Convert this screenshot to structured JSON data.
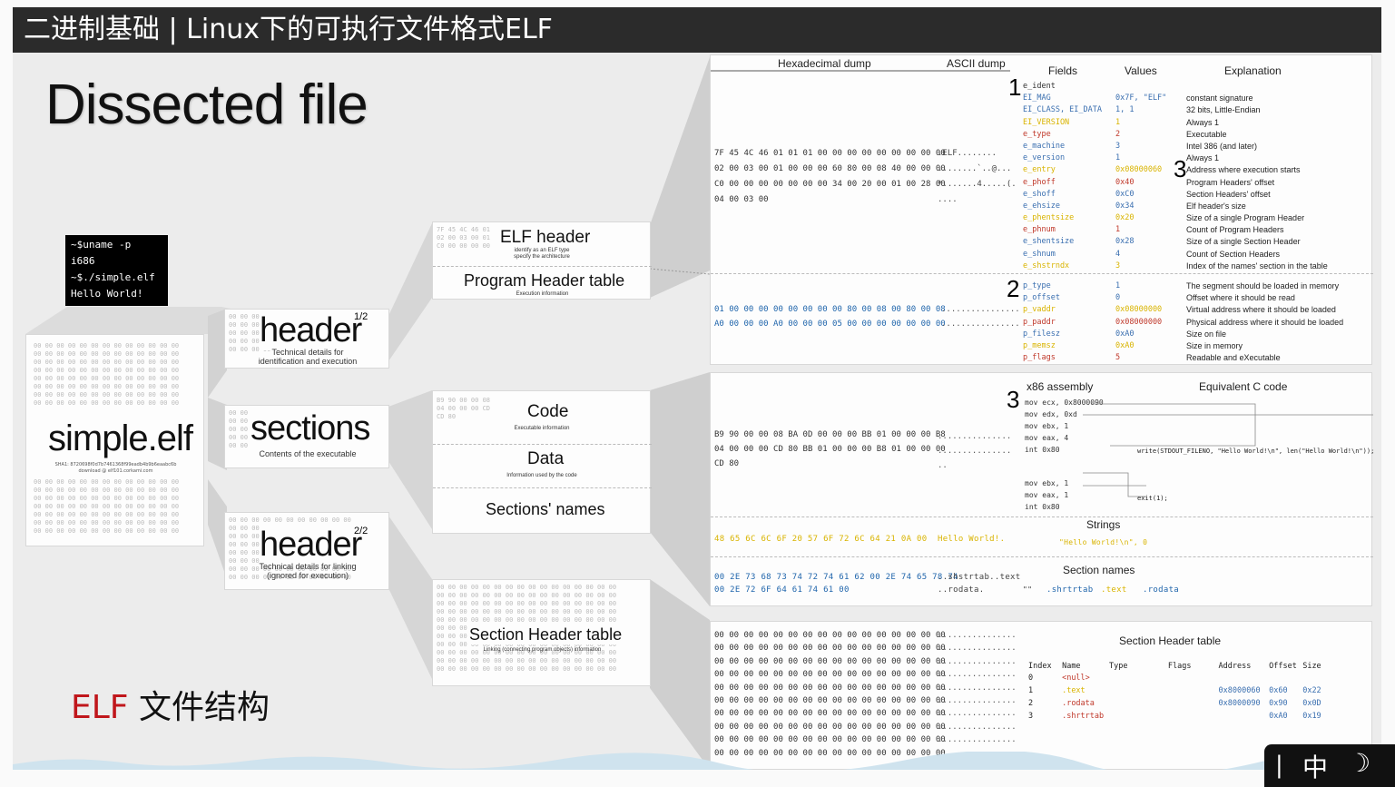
{
  "title": "二进制基础 | Linux下的可执行文件格式ELF",
  "slide_title": "Dissected file",
  "footer_caption": {
    "accent": "ELF",
    "rest": " 文件结构"
  },
  "colors": {
    "accent_red": "#c0161b",
    "title_bg": "#2b2b2b"
  },
  "terminal": {
    "lines": [
      "~$uname -p",
      "i686",
      "~$./simple.elf",
      "Hello World!"
    ]
  },
  "file": {
    "name": "simple.elf",
    "hash": "SHA1: 8720698f0d7b7461368f99eadb4b9b6eaabc6b",
    "download": "download @ elf101.corkami.com"
  },
  "level1": [
    {
      "title": "header",
      "sup": "1/2",
      "sub": [
        "Technical details for",
        "identification and execution"
      ]
    },
    {
      "title": "sections",
      "sub": [
        "Contents of the executable"
      ]
    },
    {
      "title": "header",
      "sup": "2/2",
      "sub": [
        "Technical details for linking",
        "(ignored for execution)"
      ]
    }
  ],
  "level2": {
    "elf_header": {
      "title": "ELF header",
      "sub": [
        "identify as an ELF type",
        "specify the architecture"
      ]
    },
    "program_header": {
      "title": "Program Header table",
      "sub": [
        "Execution information"
      ]
    },
    "code": {
      "title": "Code",
      "sub": [
        "Executable information"
      ]
    },
    "data": {
      "title": "Data",
      "sub": [
        "Information used by the code"
      ]
    },
    "section_names": {
      "title": "Sections' names"
    },
    "section_header": {
      "title": "Section Header table",
      "sub": [
        "Linking (connecting program objects) information"
      ]
    }
  },
  "detail": {
    "col_hex": "Hexadecimal dump",
    "col_ascii": "ASCII dump",
    "col_fields": "Fields",
    "col_values": "Values",
    "col_explanation": "Explanation",
    "markers": {
      "one": "1",
      "two": "2",
      "three": "3"
    },
    "elf_hex_rows": [
      "7F 45 4C 46 01 01 01 00 00 00 00 00 00 00 00 00",
      "02 00 03 00 01 00 00 00 60 80 00 08 40 00 00 00",
      "C0 00 00 00 00 00 00 00 34 00 20 00 01 00 28 00",
      "04 00 03 00"
    ],
    "elf_ascii_rows": [
      ".ELF........",
      "........`..@...",
      "*.......4.....(.",
      "...."
    ],
    "elf_fields": [
      "e_ident",
      "EI_MAG",
      "EI_CLASS, EI_DATA",
      "EI_VERSION",
      "e_type",
      "e_machine",
      "e_version",
      "e_entry",
      "e_phoff",
      "e_shoff",
      "e_ehsize",
      "e_phentsize",
      "e_phnum",
      "e_shentsize",
      "e_shnum",
      "e_shstrndx"
    ],
    "elf_values": [
      "",
      "0x7F, \"ELF\"",
      "1, 1",
      "1",
      "2",
      "3",
      "1",
      "0x08000060",
      "0x40",
      "0xC0",
      "0x34",
      "0x20",
      "1",
      "0x28",
      "4",
      "3"
    ],
    "elf_expl": [
      "",
      "constant signature",
      "32 bits, Little-Endian",
      "Always 1",
      "Executable",
      "Intel 386 (and later)",
      "Always 1",
      "Address where execution starts",
      "Program Headers' offset",
      "Section Headers' offset",
      "Elf header's size",
      "Size of a single Program Header",
      "Count of Program Headers",
      "Size of a single Section Header",
      "Count of Section Headers",
      "Index of the names' section in the table"
    ],
    "ph_hex_rows": [
      "01 00 00 00 00 00 00 00 00 80 00 08 00 80 00 08",
      "A0 00 00 00 A0 00 00 00 05 00 00 00 00 00 00 00"
    ],
    "ph_fields": [
      "p_type",
      "p_offset",
      "p_vaddr",
      "p_paddr",
      "p_filesz",
      "p_memsz",
      "p_flags"
    ],
    "ph_values": [
      "1",
      "0",
      "0x08000000",
      "0x08000000",
      "0xA0",
      "0xA0",
      "5"
    ],
    "ph_expl": [
      "The segment should be loaded in memory",
      "Offset where it should be read",
      "Virtual address where it should be loaded",
      "Physical address where it should be loaded",
      "Size on file",
      "Size in memory",
      "Readable and eXecutable"
    ],
    "asm_title": "x86 assembly",
    "c_title": "Equivalent C code",
    "code_hex_rows": [
      "B9 90 00 00 08 BA 0D 00 00 00 BB 01 00 00 00 B8",
      "04 00 00 00 CD 80 BB 01 00 00 00 B8 01 00 00 00",
      "CD 80"
    ],
    "asm_lines": [
      "mov ecx, 0x8000090",
      "mov edx, 0xd",
      "mov ebx, 1",
      "mov eax, 4",
      "int 0x80",
      "mov ebx, 1",
      "mov eax, 1",
      "int 0x80"
    ],
    "c_write": "write(STDOUT_FILENO, \"Hello World!\\n\", len(\"Hello World!\\n\"));",
    "c_exit": "exit(1);",
    "strings_title": "Strings",
    "strings_hex": "48 65 6C 6C 6F 20 57 6F 72 6C 64 21 0A 00",
    "strings_ascii": "Hello World!.",
    "strings_value": "\"Hello World!\\n\", 0",
    "names_title": "Section names",
    "names_hex_rows": [
      "00 2E 73 68 73 74 72 74 61 62 00 2E 74 65 78 74",
      "00 2E 72 6F 64 61 74 61 00"
    ],
    "names_ascii_rows": [
      "..shstrtab..text",
      "..rodata."
    ],
    "names_values": [
      "\"\"",
      ".shrtrtab",
      ".text",
      ".rodata"
    ],
    "sht_title": "Section Header table",
    "sht_cols": [
      "Index",
      "Name",
      "Type",
      "Flags",
      "Address",
      "Offset",
      "Size"
    ],
    "sht_rows": [
      {
        "index": "0",
        "name": "<null>",
        "address": "",
        "offset": "",
        "size": ""
      },
      {
        "index": "1",
        "name": ".text",
        "address": "0x8000060",
        "offset": "0x60",
        "size": "0x22"
      },
      {
        "index": "2",
        "name": ".rodata",
        "address": "0x8000090",
        "offset": "0x90",
        "size": "0x0D"
      },
      {
        "index": "3",
        "name": ".shrtrtab",
        "address": "",
        "offset": "0xA0",
        "size": "0x19"
      }
    ]
  }
}
